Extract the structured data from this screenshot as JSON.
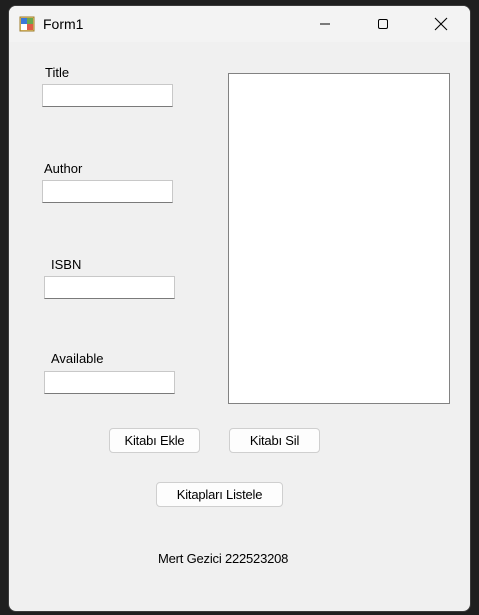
{
  "window": {
    "title": "Form1",
    "icon": "winforms-app-icon",
    "controls": {
      "minimize_icon": "minimize-icon",
      "maximize_icon": "maximize-icon",
      "close_icon": "close-icon"
    }
  },
  "form": {
    "fields": [
      {
        "label": "Title",
        "value": ""
      },
      {
        "label": "Author",
        "value": ""
      },
      {
        "label": "ISBN",
        "value": ""
      },
      {
        "label": "Available",
        "value": ""
      }
    ],
    "list": {
      "items": []
    },
    "buttons": {
      "add_label": "Kitabı Ekle",
      "delete_label": "Kitabı Sil",
      "list_label": "Kitapları Listele"
    },
    "footer": "Mert Gezici 222523208"
  }
}
